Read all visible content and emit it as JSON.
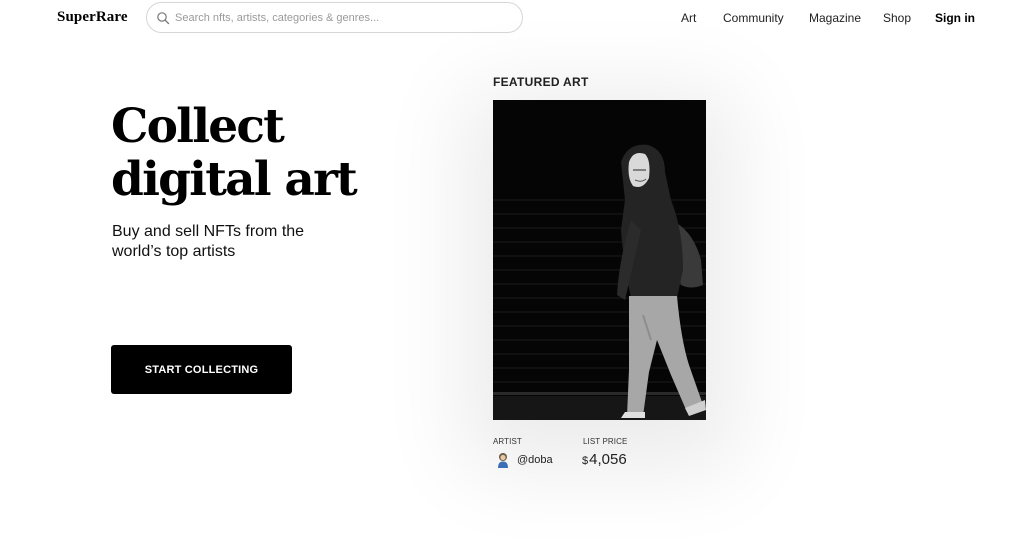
{
  "header": {
    "logo": "SuperRare",
    "search_placeholder": "Search nfts, artists, categories & genres...",
    "nav": {
      "art": "Art",
      "community": "Community",
      "magazine": "Magazine",
      "shop": "Shop",
      "signin": "Sign in"
    }
  },
  "hero": {
    "title_line1": "Collect",
    "title_line2": "digital art",
    "subtitle": "Buy and sell NFTs from the world’s top artists",
    "cta": "START COLLECTING"
  },
  "featured": {
    "label": "FEATURED ART",
    "artist_label": "ARTIST",
    "artist": "@doba",
    "price_label": "LIST PRICE",
    "currency": "$",
    "price": "4,056"
  },
  "colors": {
    "cta_background": "#000000",
    "cta_text": "#ffffff",
    "text": "#111111"
  }
}
